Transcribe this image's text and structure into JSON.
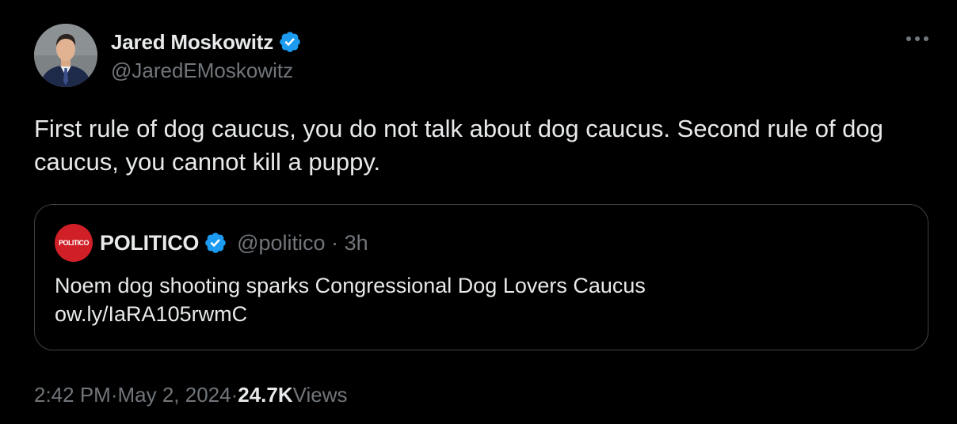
{
  "author": {
    "display_name": "Jared Moskowitz",
    "handle": "@JaredEMoskowitz",
    "verified": true
  },
  "tweet": {
    "text": "First rule of dog caucus, you do not talk about dog caucus. Second rule of dog caucus, you cannot kill a puppy."
  },
  "quote": {
    "logo_text": "POLITICO",
    "display_name": "POLITICO",
    "handle": "@politico",
    "separator": "·",
    "time_ago": "3h",
    "text_line1": "Noem dog shooting sparks Congressional Dog Lovers Caucus",
    "text_line2": "ow.ly/IaRA105rwmC"
  },
  "meta": {
    "time": "2:42 PM",
    "separator": "·",
    "date": "May 2, 2024",
    "views_count": "24.7K",
    "views_label": "Views"
  },
  "icons": {
    "verified": "verified-badge-icon",
    "more": "more-horizontal-icon"
  },
  "colors": {
    "background": "#000000",
    "text_primary": "#e7e9ea",
    "text_secondary": "#71767b",
    "verified_blue": "#1d9bf0",
    "politico_red": "#d11f27",
    "card_border": "#3e4144"
  }
}
